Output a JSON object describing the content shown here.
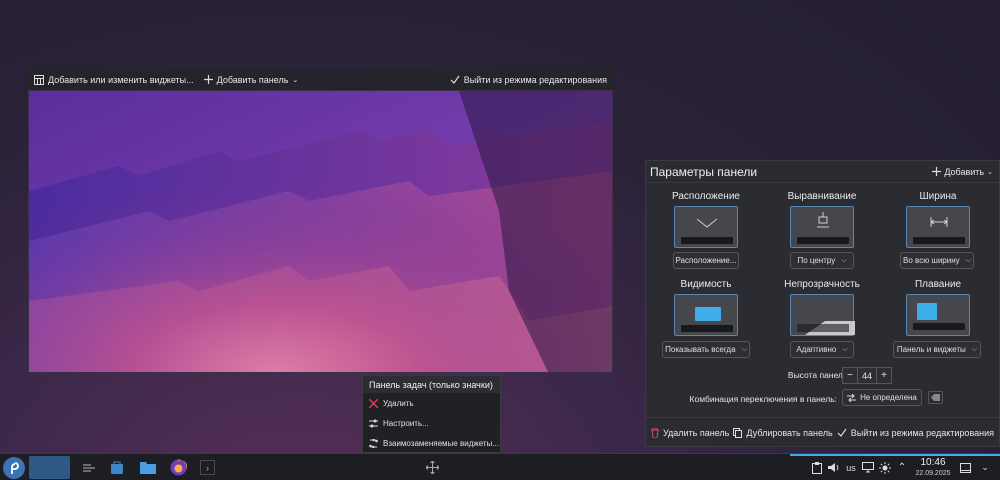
{
  "topbar": {
    "widgets_label": "Добавить или изменить виджеты...",
    "add_panel_label": "Добавить панель",
    "exit_label": "Выйти из режима редактирования"
  },
  "panel_config": {
    "title": "Параметры панели",
    "add_label": "Добавить",
    "position": {
      "label": "Расположение",
      "value": "Расположение..."
    },
    "alignment": {
      "label": "Выравнивание",
      "value": "По центру"
    },
    "width": {
      "label": "Ширина",
      "value": "Во всю ширину"
    },
    "visibility": {
      "label": "Видимость",
      "value": "Показывать всегда"
    },
    "opacity": {
      "label": "Непрозрачность",
      "value": "Адаптивно"
    },
    "floating": {
      "label": "Плавание",
      "value": "Панель и виджеты"
    },
    "height": {
      "label": "Высота панели:",
      "value": "44",
      "minus": "−",
      "plus": "+"
    },
    "shortcut": {
      "label": "Комбинация переключения в панель:",
      "value": "Не определена"
    },
    "delete_label": "Удалить панель",
    "duplicate_label": "Дублировать панель",
    "exit_label": "Выйти из режима редактирования"
  },
  "context_menu": {
    "title": "Панель задач (только значки)",
    "items": [
      "Удалить",
      "Настроить...",
      "Взаимозаменяемые виджеты..."
    ]
  },
  "taskbar": {
    "layout": "us",
    "time": "10:46",
    "date": "22.09.2025"
  },
  "colors": {
    "accent": "#3daee9",
    "background": "#2b2c32"
  }
}
